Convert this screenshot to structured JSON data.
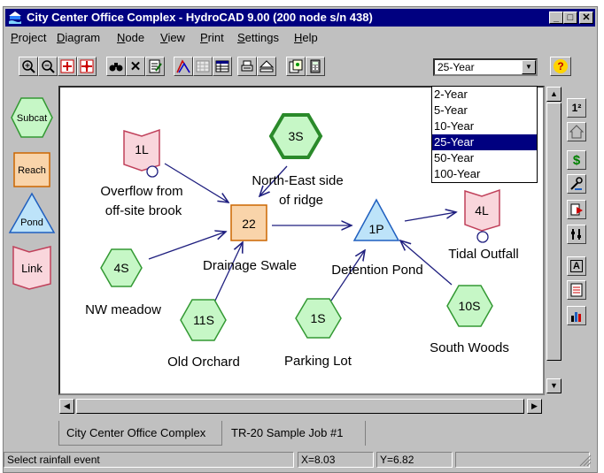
{
  "window": {
    "title": "City Center Office Complex - HydroCAD 9.00 (200 node s/n 438)",
    "controls": {
      "minimize": "_",
      "maximize": "□",
      "close": "✕"
    }
  },
  "menu": [
    "Project",
    "Diagram",
    "Node",
    "View",
    "Print",
    "Settings",
    "Help"
  ],
  "toolbar": {
    "rainfall_selected": "25-Year",
    "rainfall_options": [
      "2-Year",
      "5-Year",
      "10-Year",
      "25-Year",
      "50-Year",
      "100-Year"
    ],
    "help_glyph": "?"
  },
  "palette": [
    {
      "label": "Subcat",
      "icon": "hexagon-icon"
    },
    {
      "label": "Reach",
      "icon": "square-icon"
    },
    {
      "label": "Pond",
      "icon": "triangle-icon"
    },
    {
      "label": "Link",
      "icon": "flag-icon"
    }
  ],
  "nodes": [
    {
      "id": "1L",
      "type": "link",
      "caption": [
        "Overflow from",
        "off-site brook"
      ]
    },
    {
      "id": "3S",
      "type": "subcat",
      "caption": [
        "North-East side",
        "of ridge"
      ],
      "highlight": true
    },
    {
      "id": "22",
      "type": "reach",
      "caption": [
        "Drainage Swale"
      ]
    },
    {
      "id": "1P",
      "type": "pond",
      "caption": [
        "Detention Pond"
      ]
    },
    {
      "id": "4L",
      "type": "link",
      "caption": [
        "Tidal Outfall"
      ]
    },
    {
      "id": "4S",
      "type": "subcat",
      "caption": [
        "NW meadow"
      ]
    },
    {
      "id": "11S",
      "type": "subcat",
      "caption": [
        "Old Orchard"
      ]
    },
    {
      "id": "1S",
      "type": "subcat",
      "caption": [
        "Parking Lot"
      ]
    },
    {
      "id": "10S",
      "type": "subcat",
      "caption": [
        "South Woods"
      ]
    }
  ],
  "tabs": [
    "City Center Office Complex",
    "TR-20 Sample Job #1"
  ],
  "status": {
    "message": "Select rainfall event",
    "x": "X=8.03",
    "y": "Y=6.82"
  },
  "right_tools": [
    "1²",
    "home-icon",
    "$",
    "tools-icon",
    "export-icon",
    "settings-icon",
    "A",
    "report-icon",
    "chart-icon"
  ],
  "colors": {
    "subcat_fill": "#c6f7c6",
    "subcat_stroke": "#339933",
    "reach_fill": "#f9d4aa",
    "pond_fill": "#bde3f9",
    "link_fill": "#f9d6dc",
    "titlebar": "#000080"
  }
}
